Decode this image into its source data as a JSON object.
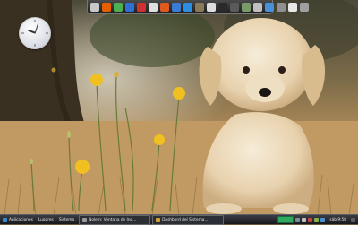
{
  "desktop": {
    "wallpaper": "puppy-in-dandelion-field",
    "clock_widget": {
      "time": "9:58"
    }
  },
  "dock": {
    "icons": [
      {
        "name": "settings-icon",
        "color": "#c8c8c8"
      },
      {
        "name": "firefox-icon",
        "color": "#e66000"
      },
      {
        "name": "chrome-icon",
        "color": "#4caf50"
      },
      {
        "name": "browser-icon",
        "color": "#2f6fd6"
      },
      {
        "name": "tool-icon",
        "color": "#d03030"
      },
      {
        "name": "app-icon",
        "color": "#e0e0e0"
      },
      {
        "name": "media-icon",
        "color": "#e05a20"
      },
      {
        "name": "mail-icon",
        "color": "#3a7bd5"
      },
      {
        "name": "globe-icon",
        "color": "#2d8de0"
      },
      {
        "name": "gimp-icon",
        "color": "#8a7a5a"
      },
      {
        "name": "editor-icon",
        "color": "#dddddd"
      },
      {
        "name": "terminal-icon",
        "color": "#2a2a2a"
      },
      {
        "name": "files-icon",
        "color": "#5a5a5a"
      },
      {
        "name": "image-icon",
        "color": "#7a9a6a"
      },
      {
        "name": "apps-icon",
        "color": "#c0c0c0"
      },
      {
        "name": "calendar-icon",
        "color": "#4a90d9"
      },
      {
        "name": "display-icon",
        "color": "#909090"
      },
      {
        "name": "document-icon",
        "color": "#e8e8e8"
      },
      {
        "name": "trash-icon",
        "color": "#a0a0a0"
      }
    ]
  },
  "taskbar": {
    "menu_label": "Aplicaciones",
    "places_label": "Lugares",
    "system_label": "Sistema",
    "tasks": [
      {
        "label": "Nolem: Ventana de Ing..."
      },
      {
        "label": "Dashbord del Sistema..."
      }
    ],
    "clock": "sáb 9:58",
    "colors": {
      "panel": "#1e2126",
      "accent": "#2fa860"
    }
  }
}
